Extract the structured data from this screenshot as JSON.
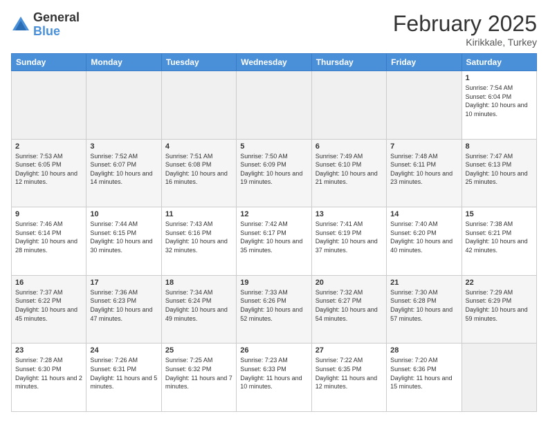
{
  "logo": {
    "general": "General",
    "blue": "Blue"
  },
  "title": {
    "month": "February 2025",
    "location": "Kirikkale, Turkey"
  },
  "headers": [
    "Sunday",
    "Monday",
    "Tuesday",
    "Wednesday",
    "Thursday",
    "Friday",
    "Saturday"
  ],
  "weeks": [
    [
      {
        "day": "",
        "sunrise": "",
        "sunset": "",
        "daylight": ""
      },
      {
        "day": "",
        "sunrise": "",
        "sunset": "",
        "daylight": ""
      },
      {
        "day": "",
        "sunrise": "",
        "sunset": "",
        "daylight": ""
      },
      {
        "day": "",
        "sunrise": "",
        "sunset": "",
        "daylight": ""
      },
      {
        "day": "",
        "sunrise": "",
        "sunset": "",
        "daylight": ""
      },
      {
        "day": "",
        "sunrise": "",
        "sunset": "",
        "daylight": ""
      },
      {
        "day": "1",
        "sunrise": "Sunrise: 7:54 AM",
        "sunset": "Sunset: 6:04 PM",
        "daylight": "Daylight: 10 hours and 10 minutes."
      }
    ],
    [
      {
        "day": "2",
        "sunrise": "Sunrise: 7:53 AM",
        "sunset": "Sunset: 6:05 PM",
        "daylight": "Daylight: 10 hours and 12 minutes."
      },
      {
        "day": "3",
        "sunrise": "Sunrise: 7:52 AM",
        "sunset": "Sunset: 6:07 PM",
        "daylight": "Daylight: 10 hours and 14 minutes."
      },
      {
        "day": "4",
        "sunrise": "Sunrise: 7:51 AM",
        "sunset": "Sunset: 6:08 PM",
        "daylight": "Daylight: 10 hours and 16 minutes."
      },
      {
        "day": "5",
        "sunrise": "Sunrise: 7:50 AM",
        "sunset": "Sunset: 6:09 PM",
        "daylight": "Daylight: 10 hours and 19 minutes."
      },
      {
        "day": "6",
        "sunrise": "Sunrise: 7:49 AM",
        "sunset": "Sunset: 6:10 PM",
        "daylight": "Daylight: 10 hours and 21 minutes."
      },
      {
        "day": "7",
        "sunrise": "Sunrise: 7:48 AM",
        "sunset": "Sunset: 6:11 PM",
        "daylight": "Daylight: 10 hours and 23 minutes."
      },
      {
        "day": "8",
        "sunrise": "Sunrise: 7:47 AM",
        "sunset": "Sunset: 6:13 PM",
        "daylight": "Daylight: 10 hours and 25 minutes."
      }
    ],
    [
      {
        "day": "9",
        "sunrise": "Sunrise: 7:46 AM",
        "sunset": "Sunset: 6:14 PM",
        "daylight": "Daylight: 10 hours and 28 minutes."
      },
      {
        "day": "10",
        "sunrise": "Sunrise: 7:44 AM",
        "sunset": "Sunset: 6:15 PM",
        "daylight": "Daylight: 10 hours and 30 minutes."
      },
      {
        "day": "11",
        "sunrise": "Sunrise: 7:43 AM",
        "sunset": "Sunset: 6:16 PM",
        "daylight": "Daylight: 10 hours and 32 minutes."
      },
      {
        "day": "12",
        "sunrise": "Sunrise: 7:42 AM",
        "sunset": "Sunset: 6:17 PM",
        "daylight": "Daylight: 10 hours and 35 minutes."
      },
      {
        "day": "13",
        "sunrise": "Sunrise: 7:41 AM",
        "sunset": "Sunset: 6:19 PM",
        "daylight": "Daylight: 10 hours and 37 minutes."
      },
      {
        "day": "14",
        "sunrise": "Sunrise: 7:40 AM",
        "sunset": "Sunset: 6:20 PM",
        "daylight": "Daylight: 10 hours and 40 minutes."
      },
      {
        "day": "15",
        "sunrise": "Sunrise: 7:38 AM",
        "sunset": "Sunset: 6:21 PM",
        "daylight": "Daylight: 10 hours and 42 minutes."
      }
    ],
    [
      {
        "day": "16",
        "sunrise": "Sunrise: 7:37 AM",
        "sunset": "Sunset: 6:22 PM",
        "daylight": "Daylight: 10 hours and 45 minutes."
      },
      {
        "day": "17",
        "sunrise": "Sunrise: 7:36 AM",
        "sunset": "Sunset: 6:23 PM",
        "daylight": "Daylight: 10 hours and 47 minutes."
      },
      {
        "day": "18",
        "sunrise": "Sunrise: 7:34 AM",
        "sunset": "Sunset: 6:24 PM",
        "daylight": "Daylight: 10 hours and 49 minutes."
      },
      {
        "day": "19",
        "sunrise": "Sunrise: 7:33 AM",
        "sunset": "Sunset: 6:26 PM",
        "daylight": "Daylight: 10 hours and 52 minutes."
      },
      {
        "day": "20",
        "sunrise": "Sunrise: 7:32 AM",
        "sunset": "Sunset: 6:27 PM",
        "daylight": "Daylight: 10 hours and 54 minutes."
      },
      {
        "day": "21",
        "sunrise": "Sunrise: 7:30 AM",
        "sunset": "Sunset: 6:28 PM",
        "daylight": "Daylight: 10 hours and 57 minutes."
      },
      {
        "day": "22",
        "sunrise": "Sunrise: 7:29 AM",
        "sunset": "Sunset: 6:29 PM",
        "daylight": "Daylight: 10 hours and 59 minutes."
      }
    ],
    [
      {
        "day": "23",
        "sunrise": "Sunrise: 7:28 AM",
        "sunset": "Sunset: 6:30 PM",
        "daylight": "Daylight: 11 hours and 2 minutes."
      },
      {
        "day": "24",
        "sunrise": "Sunrise: 7:26 AM",
        "sunset": "Sunset: 6:31 PM",
        "daylight": "Daylight: 11 hours and 5 minutes."
      },
      {
        "day": "25",
        "sunrise": "Sunrise: 7:25 AM",
        "sunset": "Sunset: 6:32 PM",
        "daylight": "Daylight: 11 hours and 7 minutes."
      },
      {
        "day": "26",
        "sunrise": "Sunrise: 7:23 AM",
        "sunset": "Sunset: 6:33 PM",
        "daylight": "Daylight: 11 hours and 10 minutes."
      },
      {
        "day": "27",
        "sunrise": "Sunrise: 7:22 AM",
        "sunset": "Sunset: 6:35 PM",
        "daylight": "Daylight: 11 hours and 12 minutes."
      },
      {
        "day": "28",
        "sunrise": "Sunrise: 7:20 AM",
        "sunset": "Sunset: 6:36 PM",
        "daylight": "Daylight: 11 hours and 15 minutes."
      },
      {
        "day": "",
        "sunrise": "",
        "sunset": "",
        "daylight": ""
      }
    ]
  ]
}
